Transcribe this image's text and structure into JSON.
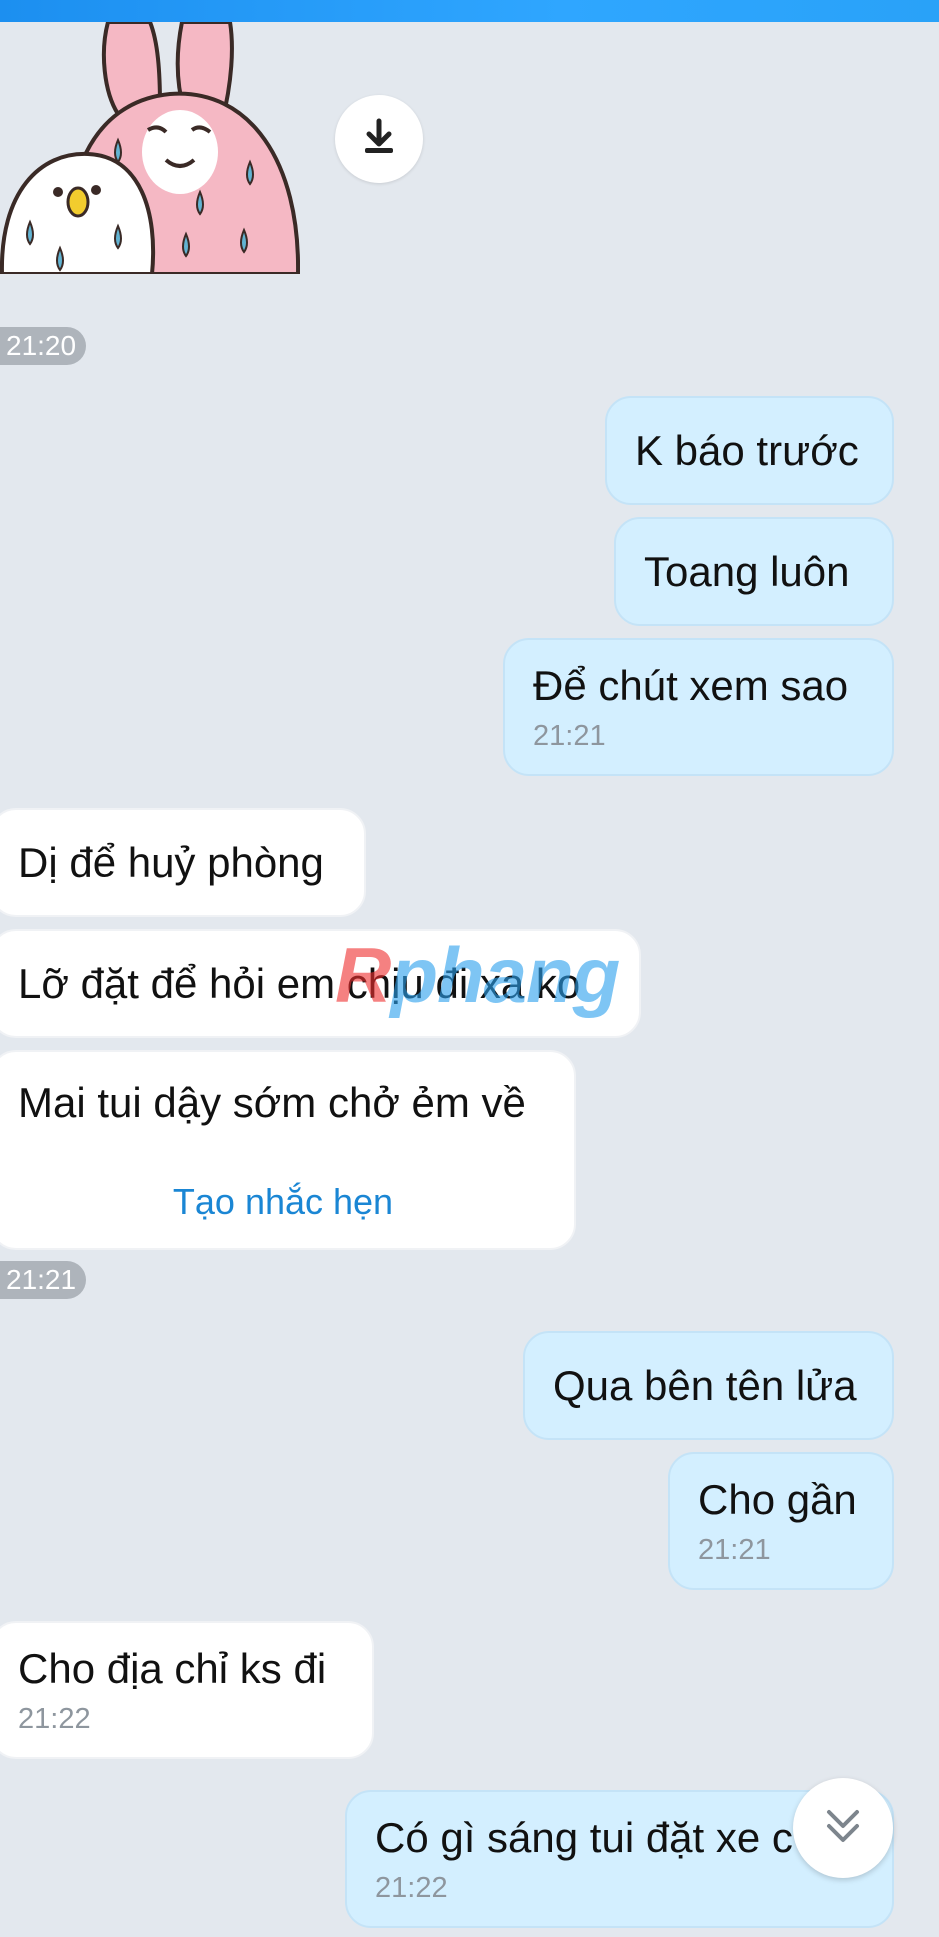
{
  "messages": {
    "ts_1": "21:20",
    "ts_2": "21:21",
    "sent_1": "K báo trước",
    "sent_2": "Toang luôn",
    "sent_3": "Để chút xem sao",
    "sent_3_time": "21:21",
    "recv_1": "Dị để huỷ phòng",
    "recv_2": "Lỡ đặt để hỏi em chịu đi xa ko",
    "recv_3": "Mai tui dậy sớm chở ẻm về",
    "remind_label": "Tạo nhắc hẹn",
    "sent_4": "Qua bên tên lửa",
    "sent_5": "Cho gần",
    "sent_5_time": "21:21",
    "recv_4": "Cho địa chỉ ks đi",
    "recv_4_time": "21:22",
    "sent_6": "Có gì sáng tui đặt xe c",
    "sent_6_time": "21:22"
  },
  "watermark": {
    "part1": "R",
    "part2": "phang"
  },
  "icons": {
    "download": "download-icon",
    "scroll_down": "chevron-double-down-icon",
    "sticker": "bunny-chick-crying-sticker"
  },
  "colors": {
    "background": "#e3e8ee",
    "sent_bubble": "#d3efff",
    "received_bubble": "#ffffff",
    "link": "#1a86d4",
    "top_bar": "#1c8ff0"
  }
}
